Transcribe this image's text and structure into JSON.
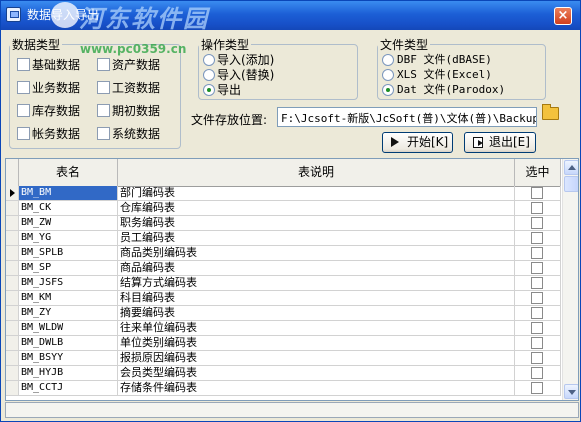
{
  "window": {
    "title": "数据导入导出",
    "watermark": "河东软件园",
    "watermark_url": "www.pc0359.cn",
    "close_label": "×"
  },
  "data_types": {
    "legend": "数据类型",
    "items": [
      {
        "label": "基础数据",
        "checked": false
      },
      {
        "label": "资产数据",
        "checked": false
      },
      {
        "label": "业务数据",
        "checked": false
      },
      {
        "label": "工资数据",
        "checked": false
      },
      {
        "label": "库存数据",
        "checked": false
      },
      {
        "label": "期初数据",
        "checked": false
      },
      {
        "label": "帐务数据",
        "checked": false
      },
      {
        "label": "系统数据",
        "checked": false
      }
    ]
  },
  "operation": {
    "legend": "操作类型",
    "options": [
      {
        "label": "导入(添加)",
        "selected": false
      },
      {
        "label": "导入(替换)",
        "selected": false
      },
      {
        "label": "导出",
        "selected": true
      }
    ]
  },
  "file_type": {
    "legend": "文件类型",
    "options": [
      {
        "label": "DBF 文件(dBASE)",
        "selected": false
      },
      {
        "label": "XLS 文件(Excel)",
        "selected": false
      },
      {
        "label": "Dat 文件(Parodox)",
        "selected": true
      }
    ]
  },
  "path": {
    "label": "文件存放位置:",
    "value": "F:\\Jcsoft-新版\\JcSoft(普)\\文体(普)\\Backup"
  },
  "buttons": {
    "start": "开始[K]",
    "exit": "退出[E]"
  },
  "table": {
    "headers": {
      "name": "表名",
      "desc": "表说明",
      "select": "选中"
    },
    "rows": [
      {
        "name": "BM_BM",
        "desc": "部门编码表",
        "selected": false
      },
      {
        "name": "BM_CK",
        "desc": "仓库编码表",
        "selected": false
      },
      {
        "name": "BM_ZW",
        "desc": "职务编码表",
        "selected": false
      },
      {
        "name": "BM_YG",
        "desc": "员工编码表",
        "selected": false
      },
      {
        "name": "BM_SPLB",
        "desc": "商品类别编码表",
        "selected": false
      },
      {
        "name": "BM_SP",
        "desc": "商品编码表",
        "selected": false
      },
      {
        "name": "BM_JSFS",
        "desc": "结算方式编码表",
        "selected": false
      },
      {
        "name": "BM_KM",
        "desc": "科目编码表",
        "selected": false
      },
      {
        "name": "BM_ZY",
        "desc": "摘要编码表",
        "selected": false
      },
      {
        "name": "BM_WLDW",
        "desc": "往来单位编码表",
        "selected": false
      },
      {
        "name": "BM_DWLB",
        "desc": "单位类别编码表",
        "selected": false
      },
      {
        "name": "BM_BSYY",
        "desc": "报损原因编码表",
        "selected": false
      },
      {
        "name": "BM_HYJB",
        "desc": "会员类型编码表",
        "selected": false
      },
      {
        "name": "BM_CCTJ",
        "desc": "存储条件编码表",
        "selected": false
      }
    ]
  },
  "status": {
    "text": ""
  },
  "colors": {
    "titlebar": "#1c5fd6",
    "selection": "#3169c6",
    "radio_on": "#1b8e27"
  }
}
